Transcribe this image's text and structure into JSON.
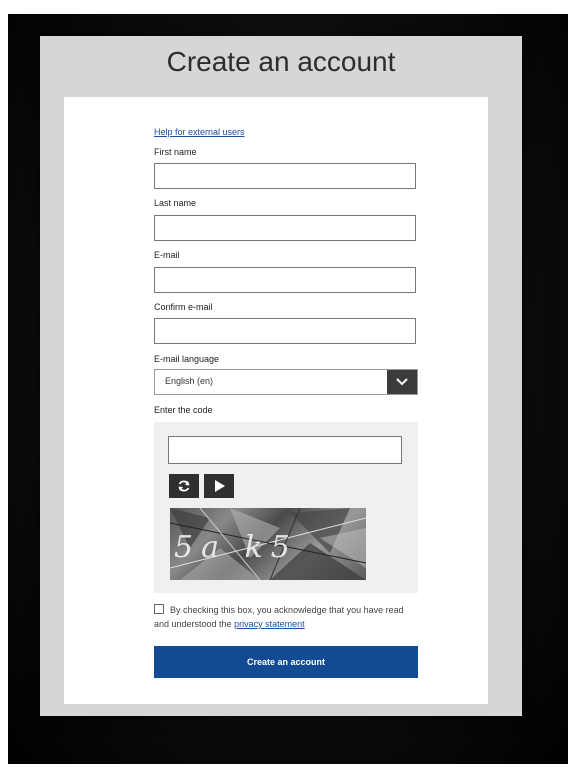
{
  "modal": {
    "title": "Create an account"
  },
  "form": {
    "help_link": "Help for external users",
    "first_name": {
      "label": "First name",
      "value": ""
    },
    "last_name": {
      "label": "Last name",
      "value": ""
    },
    "email": {
      "label": "E-mail",
      "value": ""
    },
    "confirm_email": {
      "label": "Confirm e-mail",
      "value": ""
    },
    "email_language": {
      "label": "E-mail language",
      "selected": "English (en)"
    },
    "captcha": {
      "label": "Enter the code",
      "value": "",
      "image_text": "5a k5"
    },
    "consent": {
      "text": "By checking this box, you acknowledge that you have read and understood the ",
      "link": "privacy statement"
    },
    "submit_label": "Create an account"
  },
  "colors": {
    "primary": "#124a93",
    "link": "#1f4ea1",
    "dark_button": "#2f2f2f"
  },
  "icons": {
    "dropdown": "chevron-down-icon",
    "refresh": "refresh-icon",
    "audio": "play-icon"
  }
}
